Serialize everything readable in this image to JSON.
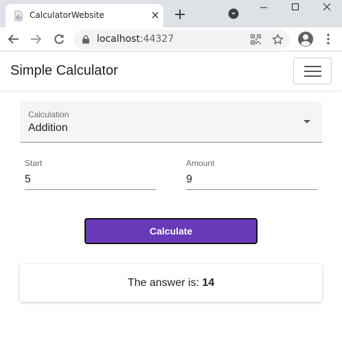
{
  "browser": {
    "tab_title": "CalculatorWebsite",
    "url_host": "localhost",
    "url_port": ":44327"
  },
  "navbar": {
    "brand": "Simple Calculator"
  },
  "form": {
    "calculation": {
      "label": "Calculation",
      "value": "Addition"
    },
    "start": {
      "label": "Start",
      "value": "5"
    },
    "amount": {
      "label": "Amount",
      "value": "9"
    },
    "button_label": "Calculate"
  },
  "result": {
    "prefix": "The answer is: ",
    "value": "14"
  },
  "colors": {
    "accent": "#673ab7",
    "chrome_frame": "#dee1e6",
    "omnibox": "#f1f3f4"
  },
  "icons": [
    "favicon-icon",
    "close-tab-icon",
    "new-tab-icon",
    "tab-search-icon",
    "minimize-icon",
    "maximize-icon",
    "close-window-icon",
    "back-icon",
    "forward-icon",
    "reload-icon",
    "lock-icon",
    "qr-code-icon",
    "bookmark-star-icon",
    "profile-icon",
    "more-menu-icon",
    "hamburger-icon",
    "dropdown-arrow-icon"
  ]
}
